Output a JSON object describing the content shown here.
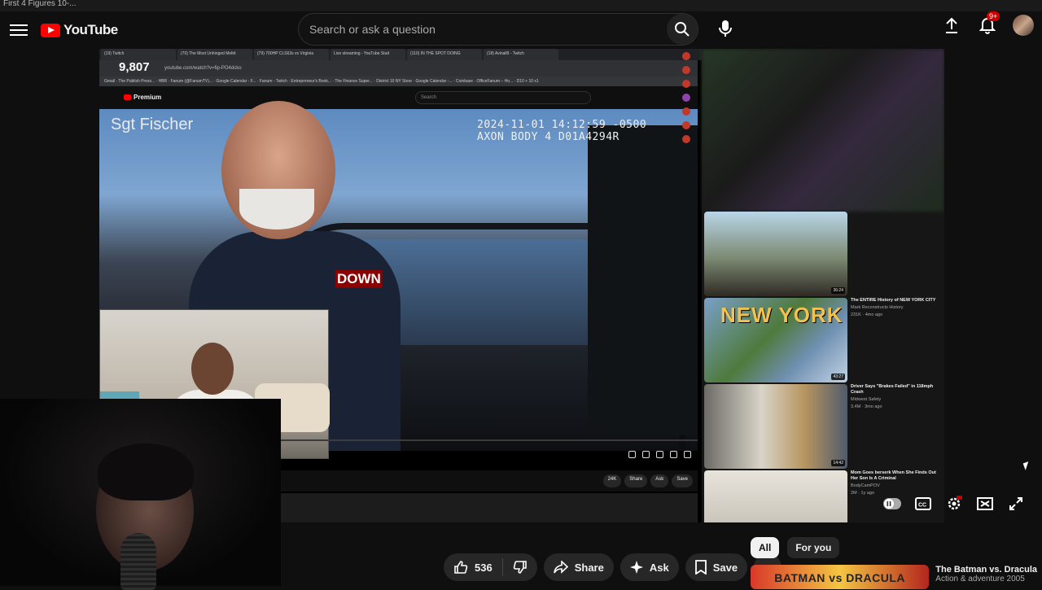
{
  "window": {
    "title": "First 4 Figures 10-..."
  },
  "masthead": {
    "logo_text": "YouTube",
    "search_placeholder": "Search or ask a question",
    "notification_count": "9+"
  },
  "player": {
    "view_count": "9,807",
    "inner_url": "youtube.com/watch?v=fip-PO4dcko",
    "inner_tabs": [
      "(19) Twitch",
      "(70) The Most Unhinged Meltd",
      "(79) 700HP CLS63s vs Virginia",
      "Live streaming - YouTube Stud",
      "(110) IN THE SPOT DOING",
      "(18) Avinall9 - Twitch"
    ],
    "inner_bookmarks": "Gmail · The Publish Press... · HBR · Fanum (@FanumTV)... · Google Calendar - F... · Fanum - Twitch · Entrepreneur's Book... · The Finance Super... · District 10 NY Store · Google Calendar -... · Coinbase · OfficeFanum – Ho... · D10 + 10 x1",
    "inner_logo": "Premium",
    "inner_search": "Search",
    "cam_name": "Sgt Fischer",
    "cam_timestamp_1": "2024-11-01 14:12:59 -0500",
    "cam_timestamp_2": "AXON BODY 4 D01A4294R",
    "cam_overlay": "DOWN",
    "inner_actions": {
      "like": "24K",
      "share": "Share",
      "ask": "Ask",
      "save": "Save"
    },
    "recommendations": [
      {
        "title": "The ENTIRE History of NEW YORK CITY",
        "channel": "Mark Reconstructs History",
        "stats": "231K · 4mo ago",
        "duration": "43:27",
        "thumb_text": "NEW YORK"
      },
      {
        "title": "Driver Says \"Brakes Failed\" in 118mph Crash",
        "channel": "Midwest Safety",
        "stats": "3.4M · 3mo ago",
        "duration": "14:42"
      },
      {
        "title": "Mom Goes berserk When She Finds Out Her Son Is A Criminal",
        "channel": "BodyCamPOV",
        "stats": "2M · 1y ago",
        "duration": ""
      }
    ],
    "rec_first_duration": "36:24"
  },
  "actions": {
    "likes": "536",
    "share": "Share",
    "ask": "Ask",
    "save": "Save"
  },
  "chips": [
    "All",
    "For you"
  ],
  "bottom_reco": {
    "title": "The Batman vs. Dracula",
    "subtitle": "Action & adventure 2005",
    "thumb_text": "BATMAN vs DRACULA"
  }
}
